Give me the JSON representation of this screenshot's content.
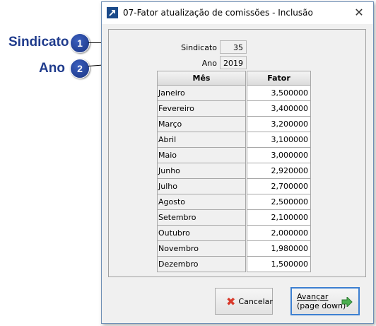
{
  "callouts": [
    {
      "label": "Sindicato",
      "number": "1"
    },
    {
      "label": "Ano",
      "number": "2"
    }
  ],
  "window": {
    "title": "07-Fator atualização de comissões - Inclusão",
    "close_symbol": "✕"
  },
  "fields": {
    "sindicato": {
      "label": "Sindicato",
      "value": "35"
    },
    "ano": {
      "label": "Ano",
      "value": "2019"
    }
  },
  "grid": {
    "headers": [
      "Mês",
      "Fator"
    ],
    "rows": [
      {
        "mes": "Janeiro",
        "fator": "3,500000"
      },
      {
        "mes": "Fevereiro",
        "fator": "3,400000"
      },
      {
        "mes": "Março",
        "fator": "3,200000"
      },
      {
        "mes": "Abril",
        "fator": "3,100000"
      },
      {
        "mes": "Maio",
        "fator": "3,000000"
      },
      {
        "mes": "Junho",
        "fator": "2,920000"
      },
      {
        "mes": "Julho",
        "fator": "2,700000"
      },
      {
        "mes": "Agosto",
        "fator": "2,500000"
      },
      {
        "mes": "Setembro",
        "fator": "2,100000"
      },
      {
        "mes": "Outubro",
        "fator": "2,000000"
      },
      {
        "mes": "Novembro",
        "fator": "1,980000"
      },
      {
        "mes": "Dezembro",
        "fator": "1,500000"
      }
    ]
  },
  "buttons": {
    "cancel": "Cancelar",
    "next_line1": "Avançar",
    "next_line2": "(page down)"
  },
  "colors": {
    "callout": "#1f3b8c",
    "focus_border": "#3c7fd1",
    "cancel_icon": "#d93a2b",
    "next_icon": "#4caf50"
  }
}
